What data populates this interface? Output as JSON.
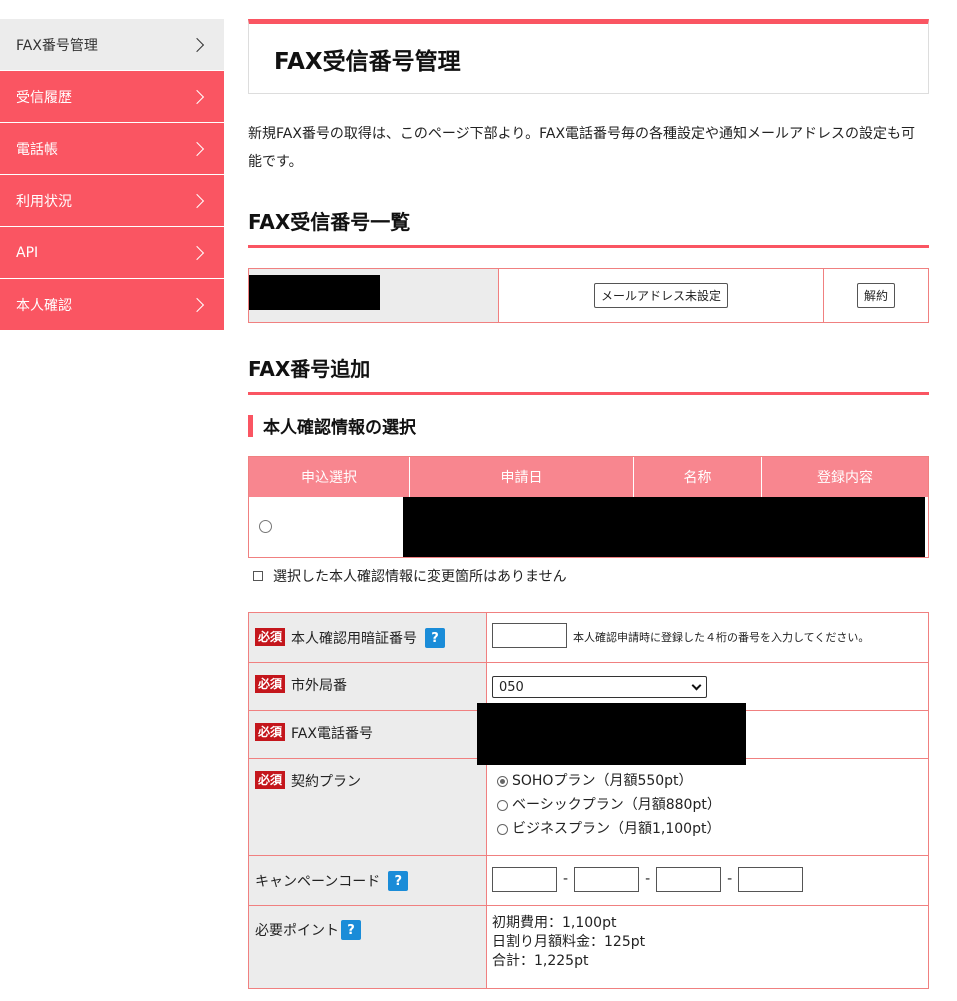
{
  "sidebar": {
    "items": [
      {
        "label": "FAX番号管理"
      },
      {
        "label": "受信履歴"
      },
      {
        "label": "電話帳"
      },
      {
        "label": "利用状況"
      },
      {
        "label": "API"
      },
      {
        "label": "本人確認"
      }
    ]
  },
  "main": {
    "title": "FAX受信番号管理",
    "intro": "新規FAX番号の取得は、このページ下部より。FAX電話番号毎の各種設定や通知メールアドレスの設定も可能です。",
    "list_heading": "FAX受信番号一覧",
    "list_row": {
      "email_button": "メールアドレス未設定",
      "cancel_button": "解約"
    },
    "add_heading": "FAX番号追加",
    "identity": {
      "heading": "本人確認情報の選択",
      "columns": [
        "申込選択",
        "申請日",
        "名称",
        "登録内容"
      ],
      "no_change_label": "選択した本人確認情報に変更箇所はありません"
    },
    "form": {
      "required_badge": "必須",
      "help_mark": "?",
      "pin_label": "本人確認用暗証番号",
      "pin_hint": "本人確認申請時に登録した４桁の番号を入力してください。",
      "area_label": "市外局番",
      "area_value": "050",
      "fax_label": "FAX電話番号",
      "plan_label": "契約プラン",
      "plans": [
        "SOHOプラン（月額550pt）",
        "ベーシックプラン（月額880pt）",
        "ビジネスプラン（月額1,100pt）"
      ],
      "selected_plan": 0,
      "campaign_label": "キャンペーンコード",
      "dash": "-",
      "points_label": "必要ポイント",
      "points": [
        "初期費用：1,100pt",
        "日割り月額料金：125pt",
        "合計：1,225pt"
      ]
    }
  },
  "colors": {
    "accent": "#fa5562",
    "table_head": "#f8868f",
    "required": "#c4161c",
    "help": "#1a8cd8"
  }
}
